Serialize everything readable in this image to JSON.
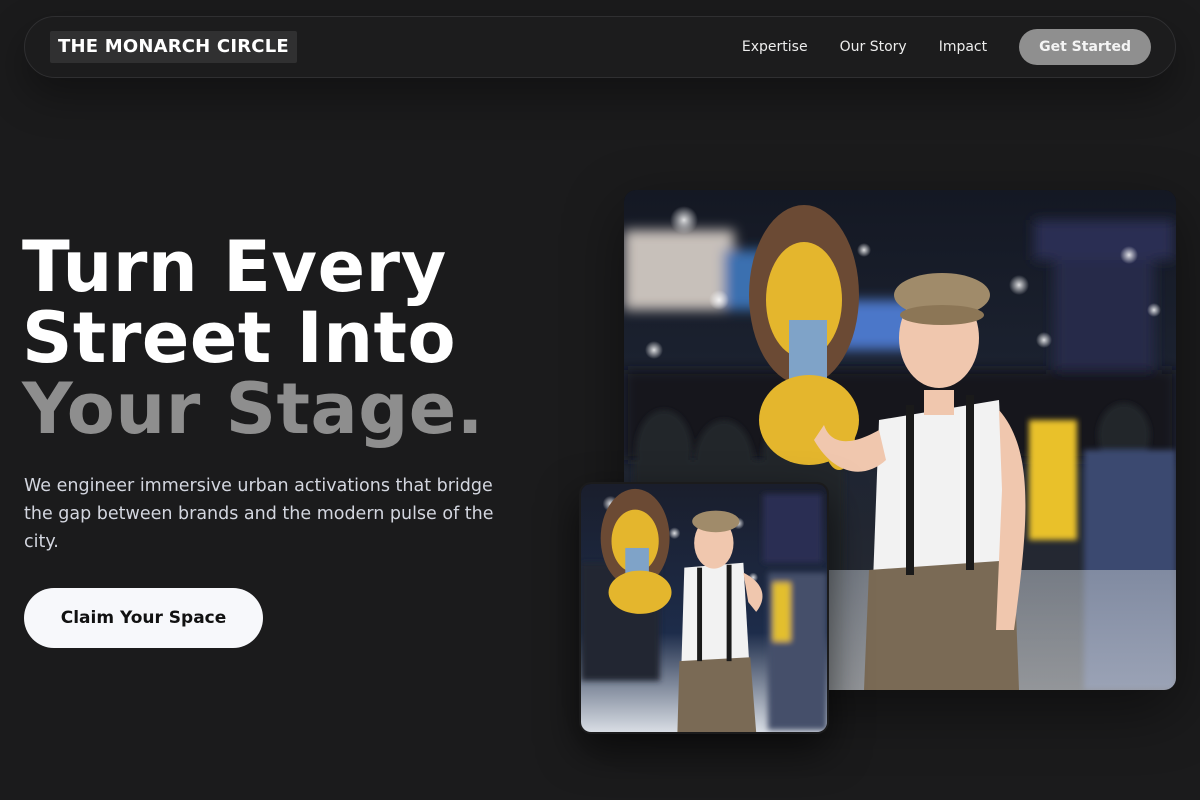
{
  "brand": {
    "logo_text": "THE MONARCH CIRCLE"
  },
  "nav": {
    "links": [
      "Expertise",
      "Our Story",
      "Impact"
    ],
    "cta_label": "Get Started"
  },
  "hero": {
    "title_line1": "Turn Every",
    "title_line2": "Street Into",
    "title_line3": "Your Stage.",
    "subtitle": "We engineer immersive urban activations that bridge the gap between brands and the modern pulse of the city.",
    "cta_label": "Claim Your Space"
  },
  "colors": {
    "background": "#1b1b1c",
    "accent_text": "#8e8e8e",
    "nav_cta": "#8f8f8f",
    "hero_cta": "#f7f8fb"
  }
}
